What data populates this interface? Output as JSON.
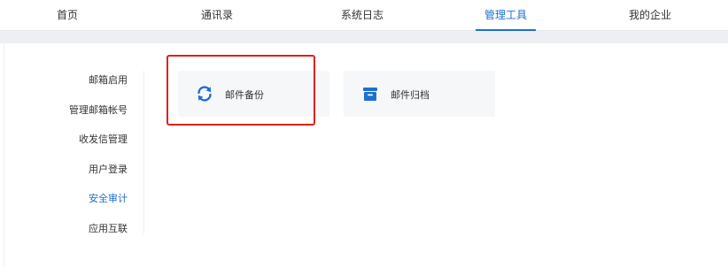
{
  "topnav": {
    "tabs": [
      {
        "label": "首页"
      },
      {
        "label": "通讯录"
      },
      {
        "label": "系统日志"
      },
      {
        "label": "管理工具",
        "active": true
      },
      {
        "label": "我的企业"
      }
    ]
  },
  "sidebar": {
    "items": [
      {
        "label": "邮箱启用"
      },
      {
        "label": "管理邮箱帐号"
      },
      {
        "label": "收发信管理"
      },
      {
        "label": "用户登录"
      },
      {
        "label": "安全审计",
        "active": true
      },
      {
        "label": "应用互联"
      }
    ]
  },
  "tools": [
    {
      "label": "邮件备份",
      "icon": "refresh-icon"
    },
    {
      "label": "邮件归档",
      "icon": "archive-box-icon"
    }
  ],
  "colors": {
    "accent": "#1e6fd0",
    "highlight": "#e0201b"
  }
}
